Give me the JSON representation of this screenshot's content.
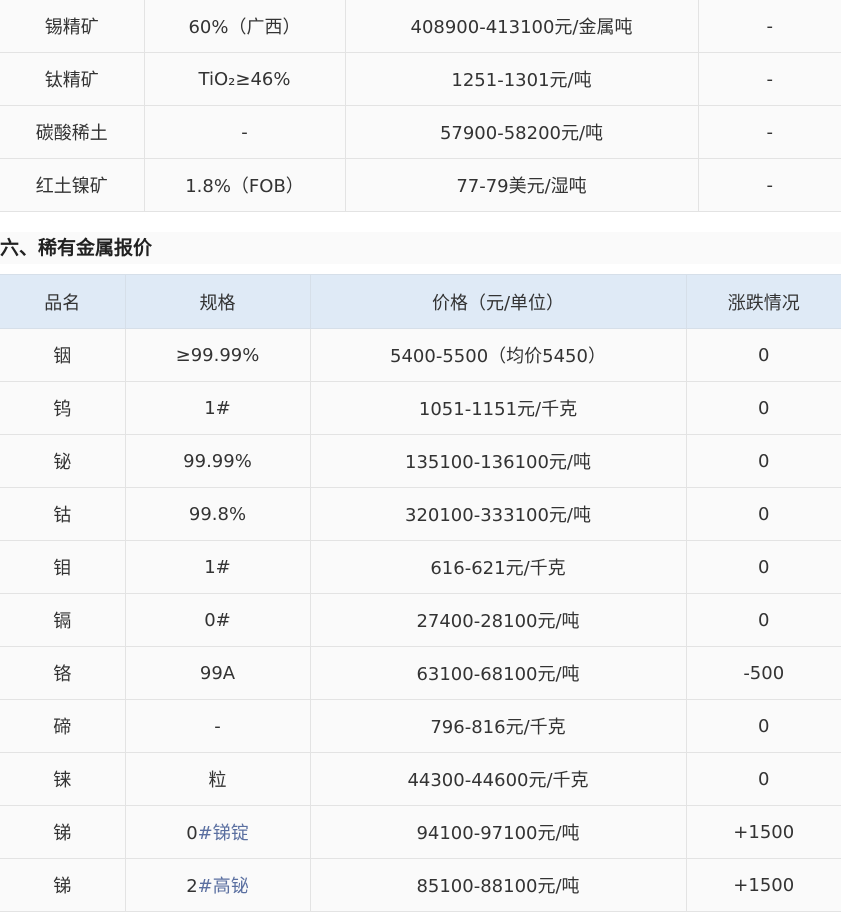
{
  "top_table": {
    "rows": [
      {
        "name": "锡精矿",
        "spec": "60%（广西）",
        "price": "408900-413100元/金属吨",
        "change": "-"
      },
      {
        "name": "钛精矿",
        "spec": "TiO₂≥46%",
        "price": "1251-1301元/吨",
        "change": "-"
      },
      {
        "name": "碳酸稀土",
        "spec": "-",
        "price": "57900-58200元/吨",
        "change": "-"
      },
      {
        "name": "红土镍矿",
        "spec": "1.8%（FOB）",
        "price": "77-79美元/湿吨",
        "change": "-"
      }
    ]
  },
  "section": {
    "title": "六、稀有金属报价"
  },
  "rare_table": {
    "headers": {
      "name": "品名",
      "spec": "规格",
      "price": "价格（元/单位）",
      "change": "涨跌情况"
    },
    "rows": [
      {
        "name": "铟",
        "spec": "≥99.99%",
        "price": "5400-5500（均价5450）",
        "change": "0"
      },
      {
        "name": "钨",
        "spec": "1#",
        "price": "1051-1151元/千克",
        "change": "0"
      },
      {
        "name": "铋",
        "spec": "99.99%",
        "price": "135100-136100元/吨",
        "change": "0"
      },
      {
        "name": "钴",
        "spec": "99.8%",
        "price": "320100-333100元/吨",
        "change": "0"
      },
      {
        "name": "钼",
        "spec": "1#",
        "price": "616-621元/千克",
        "change": "0"
      },
      {
        "name": "镉",
        "spec": "0#",
        "price": "27400-28100元/吨",
        "change": "0"
      },
      {
        "name": "铬",
        "spec": "99A",
        "price": "63100-68100元/吨",
        "change": "-500"
      },
      {
        "name": "碲",
        "spec": "-",
        "price": "796-816元/千克",
        "change": "0"
      },
      {
        "name": "铼",
        "spec": "粒",
        "price": "44300-44600元/千克",
        "change": "0"
      },
      {
        "name": "锑",
        "spec_prefix": "0",
        "spec_link": "#锑锭",
        "price": "94100-97100元/吨",
        "change": "+1500"
      },
      {
        "name": "锑",
        "spec_prefix": "2",
        "spec_link": "#高铋",
        "price": "85100-88100元/吨",
        "change": "+1500"
      }
    ]
  },
  "colors": {
    "header_bg": "#dfeaf6",
    "row_bg": "#fafafa",
    "border": "#e3e3e3",
    "link": "#5a6fa0"
  }
}
